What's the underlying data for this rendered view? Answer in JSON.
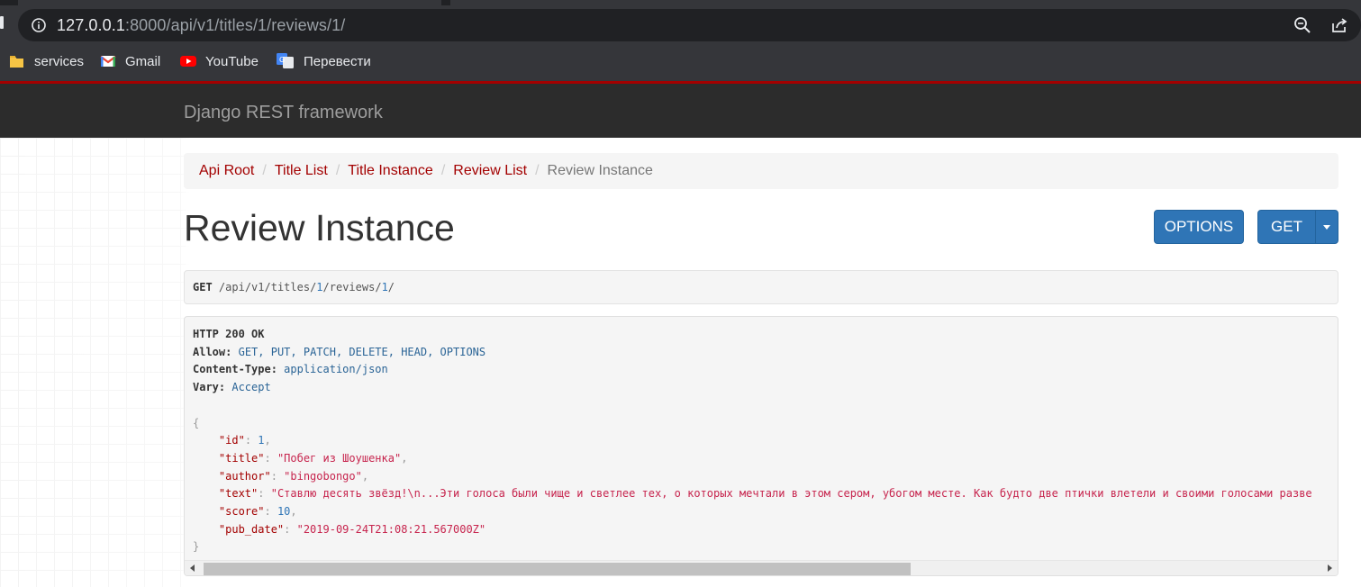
{
  "browser": {
    "url_host": "127.0.0.1",
    "url_rest": ":8000/api/v1/titles/1/reviews/1/",
    "bookmarks": [
      {
        "label": "services",
        "icon": "folder-icon"
      },
      {
        "label": "Gmail",
        "icon": "gmail-icon"
      },
      {
        "label": "YouTube",
        "icon": "youtube-icon"
      },
      {
        "label": "Перевести",
        "icon": "google-translate-icon"
      }
    ]
  },
  "navbar": {
    "brand": "Django REST framework",
    "accent_color": "#a30000"
  },
  "breadcrumb": {
    "items": [
      "Api Root",
      "Title List",
      "Title Instance",
      "Review List"
    ],
    "active": "Review Instance",
    "separator": "/"
  },
  "page": {
    "title": "Review Instance",
    "options_label": "OPTIONS",
    "get_label": "GET"
  },
  "request": {
    "method": "GET",
    "path_a": "/api/v1/titles/",
    "path_num1": "1",
    "path_b": "/reviews/",
    "path_num2": "1",
    "path_c": "/"
  },
  "response": {
    "status": "HTTP 200 OK",
    "headers": [
      {
        "key": "Allow:",
        "value": "GET, PUT, PATCH, DELETE, HEAD, OPTIONS"
      },
      {
        "key": "Content-Type:",
        "value": "application/json"
      },
      {
        "key": "Vary:",
        "value": "Accept"
      }
    ],
    "body": {
      "open": "{",
      "close": "}",
      "fields": [
        {
          "key": "\"id\"",
          "value": "1",
          "kind": "number"
        },
        {
          "key": "\"title\"",
          "value": "\"Побег из Шоушенка\"",
          "kind": "string"
        },
        {
          "key": "\"author\"",
          "value": "\"bingobongo\"",
          "kind": "string"
        },
        {
          "key": "\"text\"",
          "value": "\"Ставлю десять звёзд!\\n...Эти голоса были чище и светлее тех, о которых мечтали в этом сером, убогом месте. Как будто две птички влетели и своими голосами разве",
          "kind": "string"
        },
        {
          "key": "\"score\"",
          "value": "10",
          "kind": "number"
        },
        {
          "key": "\"pub_date\"",
          "value": "\"2019-09-24T21:08:21.567000Z\"",
          "kind": "string"
        }
      ]
    }
  }
}
